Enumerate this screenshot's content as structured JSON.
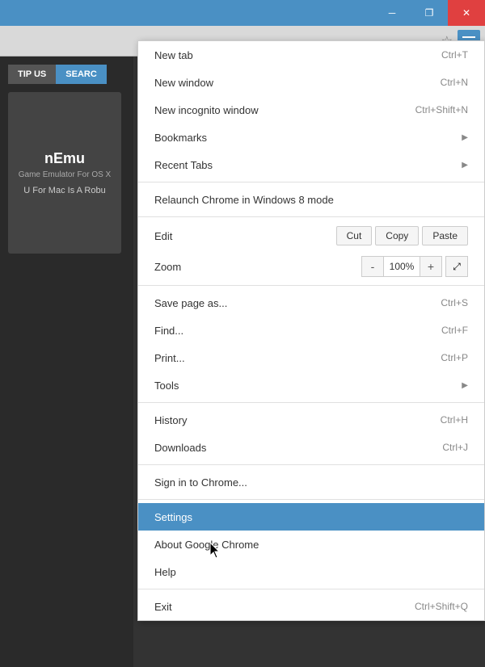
{
  "titlebar": {
    "minimize_label": "─",
    "restore_label": "❐",
    "close_label": "✕"
  },
  "browser": {
    "star_icon": "☆",
    "menu_label": "menu"
  },
  "page_bg": {
    "btn_tip": "TIP US",
    "btn_search": "SEARC",
    "emu_title": "nEmu",
    "emu_subtitle": "Game Emulator\nFor OS X",
    "emu_desc": "U For Mac Is A Robu"
  },
  "menu": {
    "items": [
      {
        "label": "New tab",
        "shortcut": "Ctrl+T",
        "arrow": false,
        "divider_after": false
      },
      {
        "label": "New window",
        "shortcut": "Ctrl+N",
        "arrow": false,
        "divider_after": false
      },
      {
        "label": "New incognito window",
        "shortcut": "Ctrl+Shift+N",
        "arrow": false,
        "divider_after": false
      },
      {
        "label": "Bookmarks",
        "shortcut": "",
        "arrow": true,
        "divider_after": false
      },
      {
        "label": "Recent Tabs",
        "shortcut": "",
        "arrow": true,
        "divider_after": true
      },
      {
        "label": "Relaunch Chrome in Windows 8 mode",
        "shortcut": "",
        "arrow": false,
        "divider_after": true
      }
    ],
    "edit": {
      "label": "Edit",
      "cut": "Cut",
      "copy": "Copy",
      "paste": "Paste"
    },
    "zoom": {
      "label": "Zoom",
      "minus": "-",
      "value": "100%",
      "plus": "+",
      "fullscreen": "⤢"
    },
    "items2": [
      {
        "label": "Save page as...",
        "shortcut": "Ctrl+S",
        "arrow": false,
        "divider_after": false
      },
      {
        "label": "Find...",
        "shortcut": "Ctrl+F",
        "arrow": false,
        "divider_after": false
      },
      {
        "label": "Print...",
        "shortcut": "Ctrl+P",
        "arrow": false,
        "divider_after": false
      },
      {
        "label": "Tools",
        "shortcut": "",
        "arrow": true,
        "divider_after": true
      }
    ],
    "items3": [
      {
        "label": "History",
        "shortcut": "Ctrl+H",
        "arrow": false,
        "divider_after": false
      },
      {
        "label": "Downloads",
        "shortcut": "Ctrl+J",
        "arrow": false,
        "divider_after": true
      }
    ],
    "items4": [
      {
        "label": "Sign in to Chrome...",
        "shortcut": "",
        "arrow": false,
        "divider_after": true
      }
    ],
    "items5": [
      {
        "label": "Settings",
        "shortcut": "",
        "arrow": false,
        "highlighted": true,
        "divider_after": false
      },
      {
        "label": "About Google Chrome",
        "shortcut": "",
        "arrow": false,
        "divider_after": false
      },
      {
        "label": "Help",
        "shortcut": "",
        "arrow": false,
        "divider_after": true
      }
    ],
    "items6": [
      {
        "label": "Exit",
        "shortcut": "Ctrl+Shift+Q",
        "arrow": false,
        "divider_after": false
      }
    ]
  }
}
